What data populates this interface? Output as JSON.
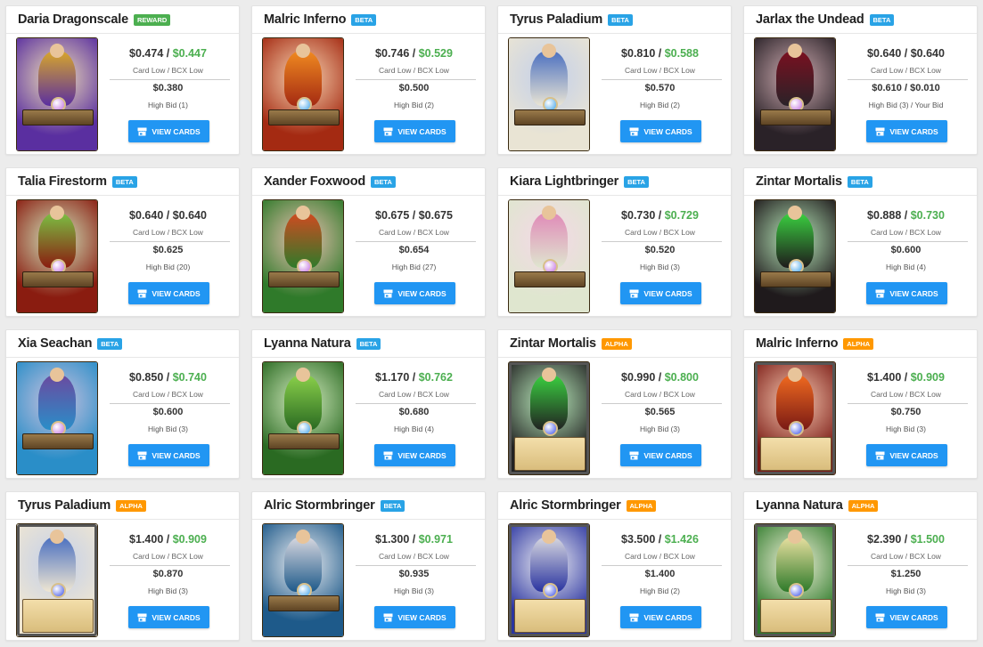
{
  "ui": {
    "price_sep": " / ",
    "button_label": "VIEW CARDS",
    "button_icon": "store-icon"
  },
  "colors": {
    "accent_blue": "#2196f3",
    "price_green": "#4caf50",
    "badge_reward": "#4caf50",
    "badge_beta": "#29a3e6",
    "badge_alpha": "#ff9800"
  },
  "cards": [
    {
      "title": "Daria Dragonscale",
      "edition": "REWARD",
      "edition_kind": "reward",
      "card_low": "$0.474",
      "bcx_low": "$0.447",
      "bcx_green": true,
      "price_label": "Card Low / BCX Low",
      "high_bid": "$0.380",
      "bid_label": "High Bid (1)",
      "art": {
        "sky": "#5a2fa0",
        "accent": "#d8a62a",
        "orb": "#c06be0"
      }
    },
    {
      "title": "Malric Inferno",
      "edition": "BETA",
      "edition_kind": "beta",
      "card_low": "$0.746",
      "bcx_low": "$0.529",
      "bcx_green": true,
      "price_label": "Card Low / BCX Low",
      "high_bid": "$0.500",
      "bid_label": "High Bid (2)",
      "art": {
        "sky": "#a42a12",
        "accent": "#f08a20",
        "orb": "#3aa0e8"
      }
    },
    {
      "title": "Tyrus Paladium",
      "edition": "BETA",
      "edition_kind": "beta",
      "card_low": "$0.810",
      "bcx_low": "$0.588",
      "bcx_green": true,
      "price_label": "Card Low / BCX Low",
      "high_bid": "$0.570",
      "bid_label": "High Bid (2)",
      "art": {
        "sky": "#e9e4d4",
        "accent": "#4a6fc0",
        "orb": "#3aa0e8"
      }
    },
    {
      "title": "Jarlax the Undead",
      "edition": "BETA",
      "edition_kind": "beta",
      "card_low": "$0.640",
      "bcx_low": "$0.640",
      "bcx_green": false,
      "price_label": "Card Low / BCX Low",
      "high_bid": "$0.610 / $0.010",
      "bid_label": "High Bid (3) / Your Bid",
      "art": {
        "sky": "#2a2228",
        "accent": "#7a1020",
        "orb": "#c06be0"
      }
    },
    {
      "title": "Talia Firestorm",
      "edition": "BETA",
      "edition_kind": "beta",
      "card_low": "$0.640",
      "bcx_low": "$0.640",
      "bcx_green": false,
      "price_label": "Card Low / BCX Low",
      "high_bid": "$0.625",
      "bid_label": "High Bid (20)",
      "art": {
        "sky": "#8a1c10",
        "accent": "#7bc043",
        "orb": "#c06be0"
      }
    },
    {
      "title": "Xander Foxwood",
      "edition": "BETA",
      "edition_kind": "beta",
      "card_low": "$0.675",
      "bcx_low": "$0.675",
      "bcx_green": false,
      "price_label": "Card Low / BCX Low",
      "high_bid": "$0.654",
      "bid_label": "High Bid (27)",
      "art": {
        "sky": "#2f7a2a",
        "accent": "#d04a20",
        "orb": "#c06be0"
      }
    },
    {
      "title": "Kiara Lightbringer",
      "edition": "BETA",
      "edition_kind": "beta",
      "card_low": "$0.730",
      "bcx_low": "$0.729",
      "bcx_green": true,
      "price_label": "Card Low / BCX Low",
      "high_bid": "$0.520",
      "bid_label": "High Bid (3)",
      "art": {
        "sky": "#dfe6cf",
        "accent": "#e08ab8",
        "orb": "#c06be0"
      }
    },
    {
      "title": "Zintar Mortalis",
      "edition": "BETA",
      "edition_kind": "beta",
      "card_low": "$0.888",
      "bcx_low": "$0.730",
      "bcx_green": true,
      "price_label": "Card Low / BCX Low",
      "high_bid": "$0.600",
      "bid_label": "High Bid (4)",
      "art": {
        "sky": "#1f1a1c",
        "accent": "#3ad040",
        "orb": "#3aa0e8"
      }
    },
    {
      "title": "Xia Seachan",
      "edition": "BETA",
      "edition_kind": "beta",
      "card_low": "$0.850",
      "bcx_low": "$0.740",
      "bcx_green": true,
      "price_label": "Card Low / BCX Low",
      "high_bid": "$0.600",
      "bid_label": "High Bid (3)",
      "art": {
        "sky": "#2a8ec8",
        "accent": "#6a4aa0",
        "orb": "#c06be0"
      }
    },
    {
      "title": "Lyanna Natura",
      "edition": "BETA",
      "edition_kind": "beta",
      "card_low": "$1.170",
      "bcx_low": "$0.762",
      "bcx_green": true,
      "price_label": "Card Low / BCX Low",
      "high_bid": "$0.680",
      "bid_label": "High Bid (4)",
      "art": {
        "sky": "#2a6a22",
        "accent": "#8ad04a",
        "orb": "#3aa0e8"
      }
    },
    {
      "title": "Zintar Mortalis",
      "edition": "ALPHA",
      "edition_kind": "alpha",
      "card_low": "$0.990",
      "bcx_low": "$0.800",
      "bcx_green": true,
      "price_label": "Card Low / BCX Low",
      "high_bid": "$0.565",
      "bid_label": "High Bid (3)",
      "art": {
        "sky": "#222",
        "accent": "#3ad040",
        "orb": "#3a50e8"
      }
    },
    {
      "title": "Malric Inferno",
      "edition": "ALPHA",
      "edition_kind": "alpha",
      "card_low": "$1.400",
      "bcx_low": "$0.909",
      "bcx_green": true,
      "price_label": "Card Low / BCX Low",
      "high_bid": "$0.750",
      "bid_label": "High Bid (3)",
      "art": {
        "sky": "#7a1a14",
        "accent": "#f06a20",
        "orb": "#3a50e8"
      }
    },
    {
      "title": "Tyrus Paladium",
      "edition": "ALPHA",
      "edition_kind": "alpha",
      "card_low": "$1.400",
      "bcx_low": "$0.909",
      "bcx_green": true,
      "price_label": "Card Low / BCX Low",
      "high_bid": "$0.870",
      "bid_label": "High Bid (3)",
      "art": {
        "sky": "#efe6d2",
        "accent": "#4a6fc0",
        "orb": "#3a50e8"
      }
    },
    {
      "title": "Alric Stormbringer",
      "edition": "BETA",
      "edition_kind": "beta",
      "card_low": "$1.300",
      "bcx_low": "$0.971",
      "bcx_green": true,
      "price_label": "Card Low / BCX Low",
      "high_bid": "$0.935",
      "bid_label": "High Bid (3)",
      "art": {
        "sky": "#1e5a8a",
        "accent": "#d8d8e0",
        "orb": "#3aa0e8"
      }
    },
    {
      "title": "Alric Stormbringer",
      "edition": "ALPHA",
      "edition_kind": "alpha",
      "card_low": "$3.500",
      "bcx_low": "$1.426",
      "bcx_green": true,
      "price_label": "Card Low / BCX Low",
      "high_bid": "$1.400",
      "bid_label": "High Bid (2)",
      "art": {
        "sky": "#2a34a0",
        "accent": "#d8d8e0",
        "orb": "#3a50e8"
      }
    },
    {
      "title": "Lyanna Natura",
      "edition": "ALPHA",
      "edition_kind": "alpha",
      "card_low": "$2.390",
      "bcx_low": "$1.500",
      "bcx_green": true,
      "price_label": "Card Low / BCX Low",
      "high_bid": "$1.250",
      "bid_label": "High Bid (3)",
      "art": {
        "sky": "#2e7a2a",
        "accent": "#e8e0a0",
        "orb": "#3a50e8"
      }
    }
  ]
}
